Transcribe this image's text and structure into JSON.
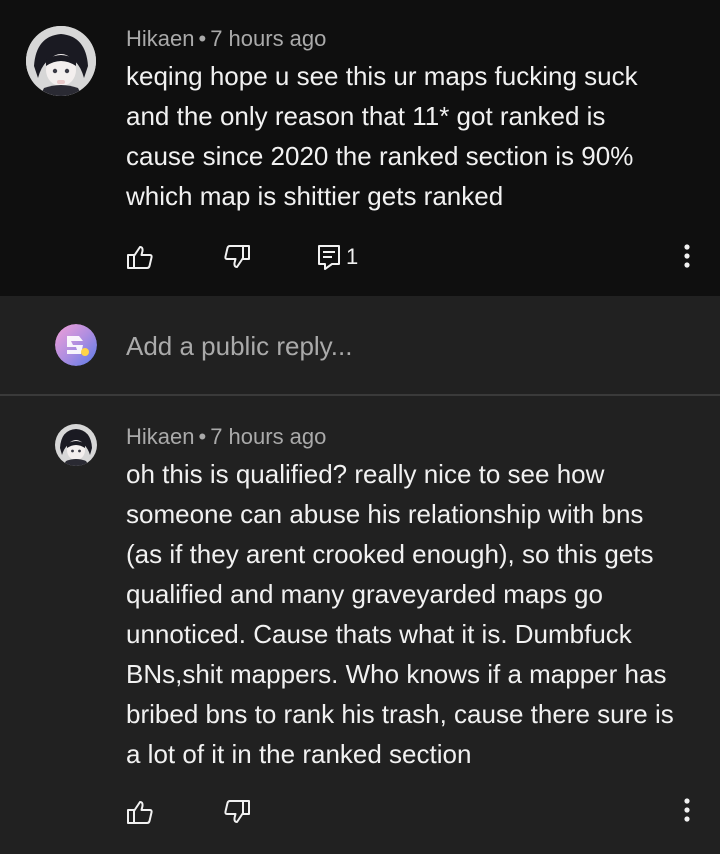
{
  "comment1": {
    "author": "Hikaen",
    "separator": "•",
    "time": "7 hours ago",
    "lines": [
      "keqing hope u see this ur maps fucking suck",
      "and the only reason that 11* got ranked is",
      "cause since 2020 the ranked section is 90%",
      "which map is shittier gets ranked"
    ],
    "reply_count": "1",
    "icons": [
      "thumbs-up-icon",
      "thumbs-down-icon",
      "reply-icon",
      "more-vertical-icon"
    ]
  },
  "reply_bar": {
    "placeholder": "Add a public reply..."
  },
  "comment2": {
    "author": "Hikaen",
    "separator": "•",
    "time": "7 hours ago",
    "lines": [
      "oh this is qualified? really nice to see how",
      "someone can abuse his relationship with bns",
      "(as if they arent crooked enough), so this gets",
      "qualified and many graveyarded maps go",
      "unnoticed. Cause thats what it is. Dumbfuck",
      "BNs,shit mappers. Who knows if a mapper has",
      "bribed bns to rank his trash, cause there sure is",
      "a lot of it in the ranked section"
    ],
    "icons": [
      "thumbs-up-icon",
      "thumbs-down-icon",
      "more-vertical-icon"
    ]
  },
  "colors": {
    "background_dark": "#0f0f0f",
    "background_panel": "#212121",
    "text_primary": "#f1f1f1",
    "text_secondary": "#aaaaaa"
  }
}
